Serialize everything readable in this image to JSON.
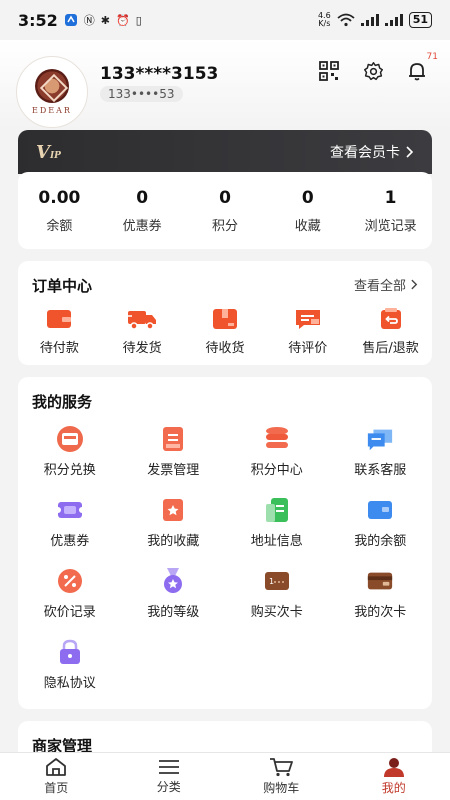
{
  "status_bar": {
    "time": "3:52",
    "speed_top": "4.6",
    "speed_bottom": "K/s",
    "battery": "51"
  },
  "user": {
    "avatar_text": "EDEAR",
    "name": "133****3153",
    "phone_masked": "133••••53"
  },
  "header": {
    "notification_count": "71"
  },
  "vip": {
    "logo_main": "V",
    "logo_sub": "IP",
    "link_label": "查看会员卡"
  },
  "stats": [
    {
      "value": "0.00",
      "label": "余额"
    },
    {
      "value": "0",
      "label": "优惠券"
    },
    {
      "value": "0",
      "label": "积分"
    },
    {
      "value": "0",
      "label": "收藏"
    },
    {
      "value": "1",
      "label": "浏览记录"
    }
  ],
  "orders": {
    "title": "订单中心",
    "link_label": "查看全部",
    "items": [
      {
        "label": "待付款",
        "icon": "wallet-icon"
      },
      {
        "label": "待发货",
        "icon": "delivery-truck-icon"
      },
      {
        "label": "待收货",
        "icon": "package-icon"
      },
      {
        "label": "待评价",
        "icon": "comment-icon"
      },
      {
        "label": "售后/退款",
        "icon": "refund-icon"
      }
    ]
  },
  "services": {
    "title": "我的服务",
    "items": [
      {
        "label": "积分兑换",
        "icon": "points-exchange-icon"
      },
      {
        "label": "发票管理",
        "icon": "invoice-icon"
      },
      {
        "label": "积分中心",
        "icon": "points-center-icon"
      },
      {
        "label": "联系客服",
        "icon": "customer-service-icon"
      },
      {
        "label": "优惠券",
        "icon": "coupon-icon"
      },
      {
        "label": "我的收藏",
        "icon": "favorites-icon"
      },
      {
        "label": "地址信息",
        "icon": "address-icon"
      },
      {
        "label": "我的余额",
        "icon": "balance-icon"
      },
      {
        "label": "砍价记录",
        "icon": "bargain-icon"
      },
      {
        "label": "我的等级",
        "icon": "level-medal-icon"
      },
      {
        "label": "购买次卡",
        "icon": "buy-card-icon"
      },
      {
        "label": "我的次卡",
        "icon": "my-card-icon"
      },
      {
        "label": "隐私协议",
        "icon": "privacy-lock-icon"
      }
    ]
  },
  "merchant": {
    "title": "商家管理"
  },
  "tabbar": {
    "items": [
      {
        "label": "首页",
        "icon": "home-icon"
      },
      {
        "label": "分类",
        "icon": "menu-icon"
      },
      {
        "label": "购物车",
        "icon": "cart-icon"
      },
      {
        "label": "我的",
        "icon": "user-icon"
      }
    ],
    "active_color": "#c0392b"
  },
  "colors": {
    "accent_orange": "#f0542d",
    "vip_gold": "#e7d3b0",
    "vip_dark": "#2d2d2f"
  }
}
